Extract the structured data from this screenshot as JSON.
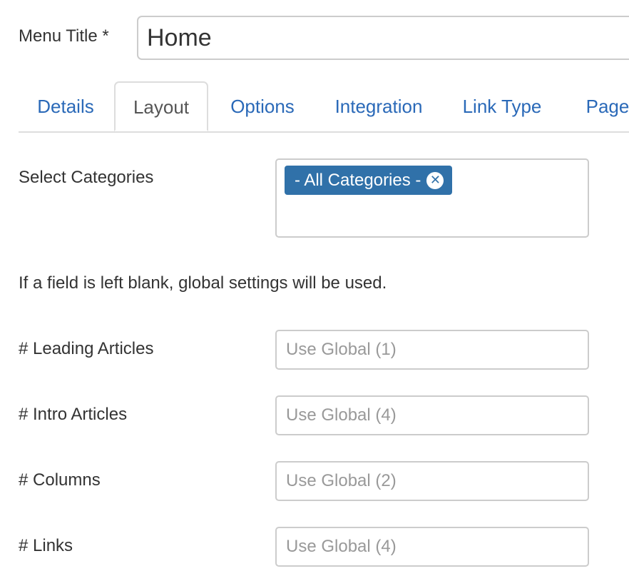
{
  "title_row": {
    "label": "Menu Title *",
    "value": "Home"
  },
  "tabs": [
    {
      "label": "Details",
      "active": false
    },
    {
      "label": "Layout",
      "active": true
    },
    {
      "label": "Options",
      "active": false
    },
    {
      "label": "Integration",
      "active": false
    },
    {
      "label": "Link Type",
      "active": false
    },
    {
      "label": "Page",
      "active": false
    }
  ],
  "categories": {
    "label": "Select Categories",
    "selected": [
      "- All Categories -"
    ],
    "remove_icon": "close-circle-icon"
  },
  "note": "If a field is left blank, global settings will be used.",
  "fields": [
    {
      "label": "# Leading Articles",
      "placeholder": "Use Global (1)"
    },
    {
      "label": "# Intro Articles",
      "placeholder": "Use Global (4)"
    },
    {
      "label": "# Columns",
      "placeholder": "Use Global (2)"
    },
    {
      "label": "# Links",
      "placeholder": "Use Global (4)"
    }
  ],
  "colors": {
    "link": "#2a69b8",
    "chip": "#3071a9",
    "border": "#cccccc"
  }
}
